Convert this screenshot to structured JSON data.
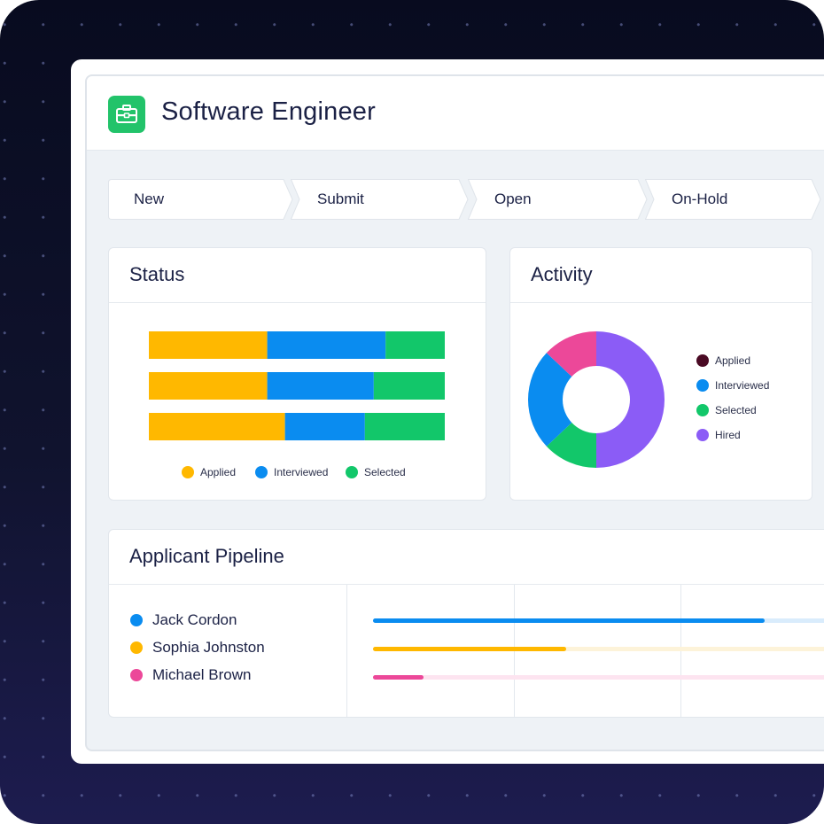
{
  "page": {
    "title": "Software Engineer",
    "icon": "briefcase-icon",
    "accent": "#22c36a"
  },
  "stages": [
    {
      "label": "New"
    },
    {
      "label": "Submit"
    },
    {
      "label": "Open"
    },
    {
      "label": "On-Hold"
    }
  ],
  "status_card": {
    "title": "Status",
    "legend": [
      {
        "label": "Applied",
        "color": "#ffb800"
      },
      {
        "label": "Interviewed",
        "color": "#0a8cf0"
      },
      {
        "label": "Selected",
        "color": "#12c76a"
      }
    ]
  },
  "activity_card": {
    "title": "Activity",
    "legend": [
      {
        "label": "Applied",
        "color": "#4a0a24"
      },
      {
        "label": "Interviewed",
        "color": "#0a8cf0"
      },
      {
        "label": "Selected",
        "color": "#12c76a"
      },
      {
        "label": "Hired",
        "color": "#8b5cf6"
      }
    ]
  },
  "pipeline_card": {
    "title": "Applicant Pipeline",
    "applicants": [
      {
        "name": "Jack Cordon",
        "color": "#0a8cf0",
        "track": "#d9ecfc",
        "progress": 0.85
      },
      {
        "name": "Sophia Johnston",
        "color": "#ffb800",
        "track": "#fdf3d9",
        "progress": 0.42
      },
      {
        "name": "Michael Brown",
        "color": "#ec4899",
        "track": "#fde4f0",
        "progress": 0.11
      }
    ]
  },
  "chart_data": [
    {
      "type": "bar",
      "stacked": true,
      "orientation": "horizontal",
      "categories": [
        "",
        "",
        ""
      ],
      "series": [
        {
          "name": "Applied",
          "values": [
            40,
            40,
            46
          ]
        },
        {
          "name": "Interviewed",
          "values": [
            40,
            36,
            27
          ]
        },
        {
          "name": "Selected",
          "values": [
            20,
            24,
            27
          ]
        }
      ],
      "grid": false,
      "legend_position": "bottom"
    },
    {
      "type": "pie",
      "donut": true,
      "labels": [
        "Hired",
        "Selected",
        "Interviewed",
        "Applied"
      ],
      "values": [
        50,
        13,
        24,
        13
      ],
      "colors": [
        "#8b5cf6",
        "#12c76a",
        "#0a8cf0",
        "#ec4899"
      ],
      "legend_position": "right"
    }
  ]
}
